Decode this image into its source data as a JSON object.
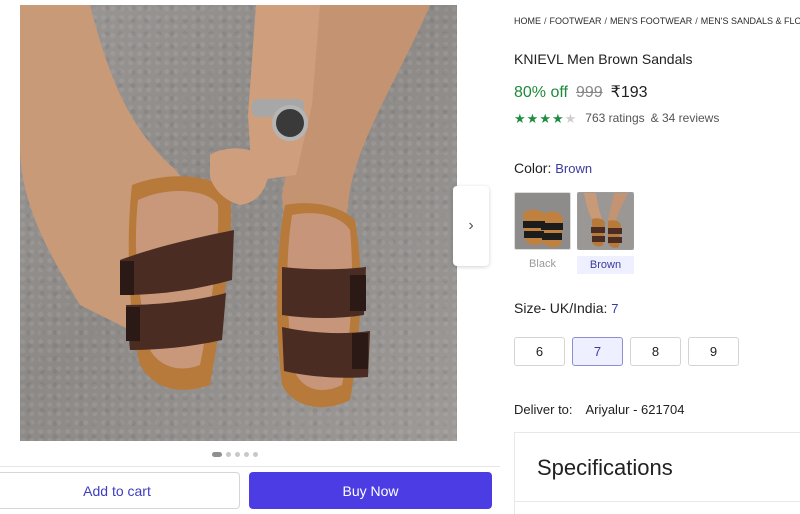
{
  "breadcrumb": [
    "HOME",
    "FOOTWEAR",
    "MEN'S FOOTWEAR",
    "MEN'S SANDALS & FLOA"
  ],
  "product": {
    "title": "KNIEVL Men Brown Sandals",
    "discount": "80% off",
    "mrp": "999",
    "price": "₹193",
    "rating_stars": 4,
    "ratings_text": "763 ratings",
    "reviews_text": "& 34 reviews"
  },
  "color": {
    "label": "Color:",
    "selected": "Brown",
    "options": [
      "Black",
      "Brown"
    ]
  },
  "size": {
    "label": "Size- UK/India:",
    "selected": "7",
    "options": [
      "6",
      "7",
      "8",
      "9"
    ]
  },
  "delivery": {
    "label": "Deliver to:",
    "location": "Ariyalur - 621704"
  },
  "specifications": {
    "title": "Specifications"
  },
  "gallery": {
    "next_icon": "›",
    "image_count": 5,
    "active_index": 0
  },
  "actions": {
    "add_to_cart": "Add to cart",
    "buy_now": "Buy Now"
  },
  "colors": {
    "accent": "#4b3de3",
    "discount_green": "#1f8a3a",
    "star_green": "#1e8e3e"
  }
}
